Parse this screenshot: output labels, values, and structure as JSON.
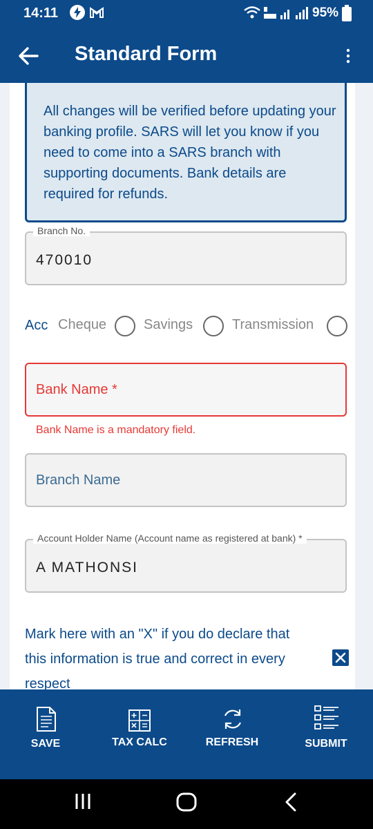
{
  "status": {
    "time": "14:11",
    "battery": "95%"
  },
  "appbar": {
    "title": "Standard Form"
  },
  "info_text": "All changes will be verified before updating your banking profile. SARS will let you know if you need to come into a SARS branch with supporting documents. Bank details are required for refunds.",
  "branch_no": {
    "label": "Branch No.",
    "value": "470010"
  },
  "account_type": {
    "label": "Acc Type",
    "options": [
      "Cheque",
      "Savings",
      "Transmission"
    ]
  },
  "bank_name": {
    "placeholder": "Bank Name  *",
    "error": "Bank Name is a mandatory field."
  },
  "branch_name": {
    "placeholder": "Branch Name"
  },
  "account_holder": {
    "label": "Account Holder Name (Account name as registered at bank) *",
    "value": "A MATHONSI"
  },
  "declaration": {
    "text": "Mark here with an \"X\" if you do declare that this information is true and correct in every respect",
    "checked": true
  },
  "toolbar": {
    "save": "SAVE",
    "tax_calc": "TAX CALC",
    "refresh": "REFRESH",
    "submit": "SUBMIT"
  },
  "colors": {
    "primary": "#0c4a8a",
    "error": "#e53935",
    "info_bg": "#dde8f0"
  }
}
